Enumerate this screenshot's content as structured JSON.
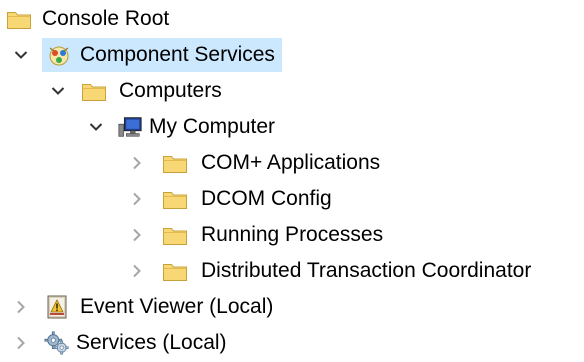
{
  "tree": {
    "root": {
      "label": "Console Root",
      "icon": "folder-icon"
    },
    "component_services": {
      "label": "Component Services",
      "icon": "component-services-icon",
      "expanded": true,
      "selected": true
    },
    "computers": {
      "label": "Computers",
      "icon": "folder-icon",
      "expanded": true
    },
    "my_computer": {
      "label": "My Computer",
      "icon": "computer-icon",
      "expanded": true
    },
    "com_apps": {
      "label": "COM+ Applications",
      "icon": "folder-icon",
      "expanded": false
    },
    "dcom_config": {
      "label": "DCOM Config",
      "icon": "folder-icon",
      "expanded": false
    },
    "running_processes": {
      "label": "Running Processes",
      "icon": "folder-icon",
      "expanded": false
    },
    "dtc": {
      "label": "Distributed Transaction Coordinator",
      "icon": "folder-icon",
      "expanded": false
    },
    "event_viewer": {
      "label": "Event Viewer (Local)",
      "icon": "event-viewer-icon",
      "expanded": false
    },
    "services": {
      "label": "Services (Local)",
      "icon": "services-gear-icon",
      "expanded": false
    }
  },
  "colors": {
    "selection": "#cce8ff",
    "folder": "#f8d775",
    "folder_outline": "#c8a13a",
    "chevron_expanded": "#333333",
    "chevron_collapsed": "#a6a6a6"
  }
}
